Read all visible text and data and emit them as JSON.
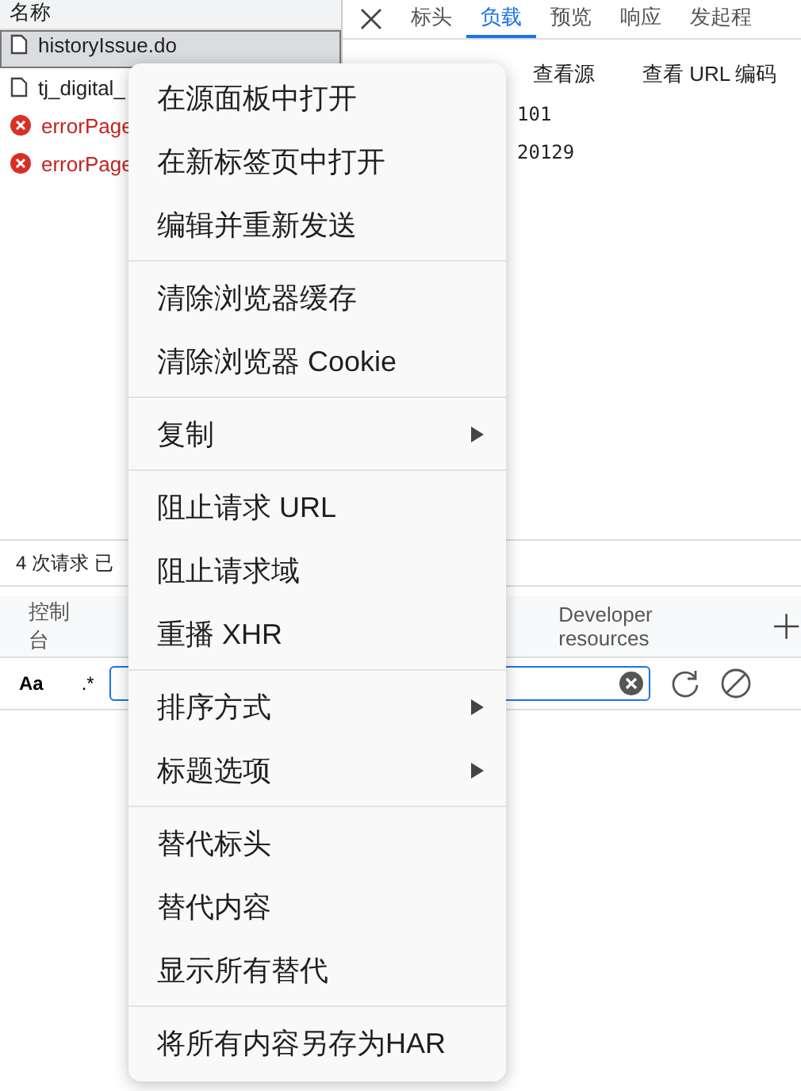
{
  "request_list": {
    "header": "名称",
    "rows": [
      {
        "name": "historyIssue.do",
        "kind": "document",
        "selected": true
      },
      {
        "name": "tj_digital_",
        "kind": "document",
        "selected": false
      },
      {
        "name": "errorPage",
        "kind": "error",
        "selected": false
      },
      {
        "name": "errorPage",
        "kind": "error",
        "selected": false
      }
    ]
  },
  "detail_tabs": [
    {
      "label": "标头",
      "selected": false
    },
    {
      "label": "负载",
      "selected": true
    },
    {
      "label": "预览",
      "selected": false
    },
    {
      "label": "响应",
      "selected": false
    },
    {
      "label": "发起程",
      "selected": false
    }
  ],
  "payload": {
    "links": [
      "查看源",
      "查看 URL 编码"
    ],
    "values": [
      "101",
      "20129"
    ]
  },
  "status_bar": "4 次请求 已",
  "drawer_tabs": [
    {
      "label": "控制台",
      "selected": false
    },
    {
      "label": "Developer resources",
      "selected": false
    }
  ],
  "filter_bar": {
    "case_toggle": "Aa",
    "regex_toggle": ".*"
  },
  "context_menu": [
    [
      {
        "label": "在源面板中打开",
        "submenu": false
      },
      {
        "label": "在新标签页中打开",
        "submenu": false
      },
      {
        "label": "编辑并重新发送",
        "submenu": false
      }
    ],
    [
      {
        "label": "清除浏览器缓存",
        "submenu": false
      },
      {
        "label": "清除浏览器 Cookie",
        "submenu": false
      }
    ],
    [
      {
        "label": "复制",
        "submenu": true
      }
    ],
    [
      {
        "label": "阻止请求 URL",
        "submenu": false
      },
      {
        "label": "阻止请求域",
        "submenu": false
      },
      {
        "label": "重播 XHR",
        "submenu": false
      }
    ],
    [
      {
        "label": "排序方式",
        "submenu": true
      },
      {
        "label": "标题选项",
        "submenu": true
      }
    ],
    [
      {
        "label": "替代标头",
        "submenu": false
      },
      {
        "label": "替代内容",
        "submenu": false
      },
      {
        "label": "显示所有替代",
        "submenu": false
      }
    ],
    [
      {
        "label": "将所有内容另存为HAR",
        "submenu": false
      }
    ]
  ]
}
